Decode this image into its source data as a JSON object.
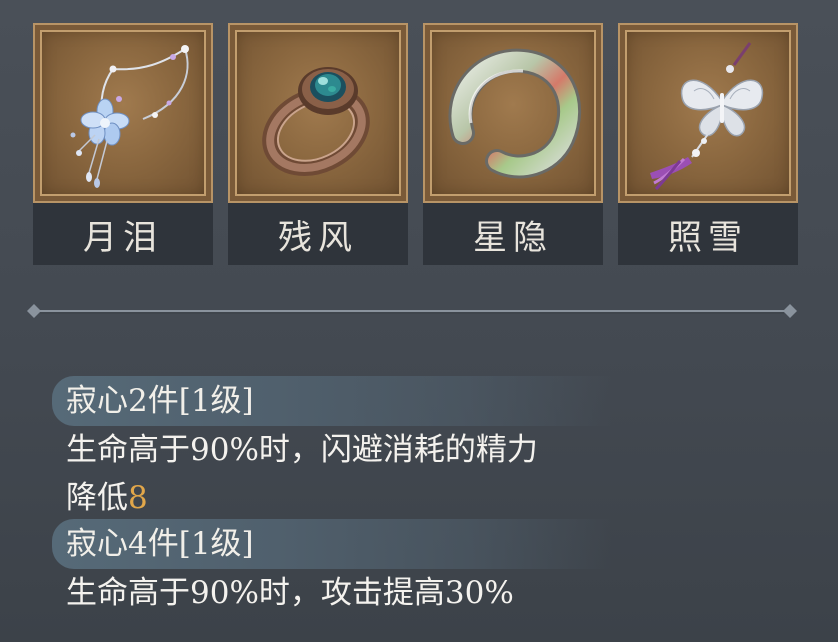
{
  "items": [
    {
      "name": "月泪",
      "icon": "necklace-icon"
    },
    {
      "name": "残风",
      "icon": "ring-icon"
    },
    {
      "name": "星隐",
      "icon": "bracelet-icon"
    },
    {
      "name": "照雪",
      "icon": "butterfly-pendant-icon"
    }
  ],
  "set_bonuses": [
    {
      "title": "寂心2件[1级]",
      "desc_line1": "生命高于90%时，闪避消耗的精力",
      "desc_line2_prefix": "降低",
      "desc_value": "8"
    },
    {
      "title": "寂心4件[1级]",
      "desc_line1": "生命高于90%时，攻击提高30%"
    }
  ],
  "colors": {
    "highlight": "#e2a74a",
    "frame_gold": "#b89466",
    "name_bar": "#2f343b",
    "background": "#454b53"
  }
}
